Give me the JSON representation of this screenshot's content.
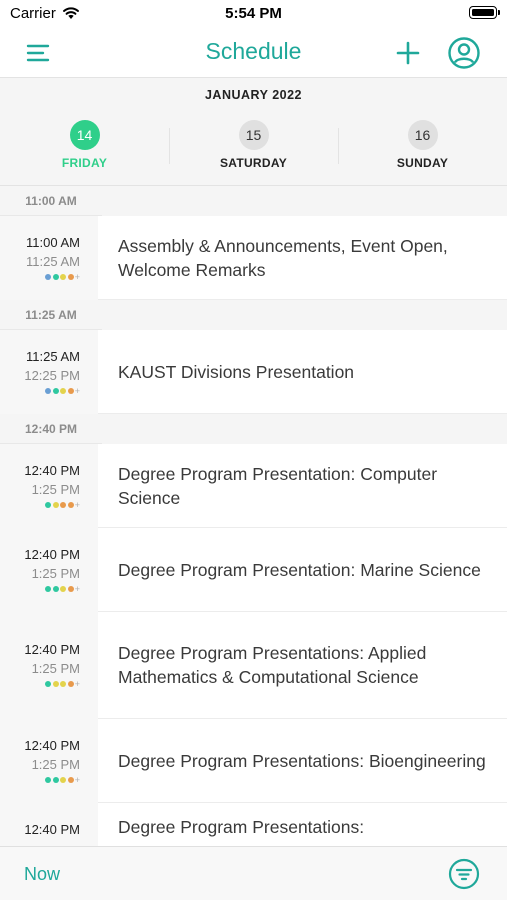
{
  "status_bar": {
    "carrier": "Carrier",
    "time": "5:54 PM"
  },
  "nav": {
    "title": "Schedule"
  },
  "calendar": {
    "month": "JANUARY 2022",
    "days": [
      {
        "num": "14",
        "name": "FRIDAY",
        "active": true
      },
      {
        "num": "15",
        "name": "SATURDAY",
        "active": false
      },
      {
        "num": "16",
        "name": "SUNDAY",
        "active": false
      }
    ]
  },
  "sections": [
    {
      "header": "11:00 AM",
      "events": [
        {
          "start": "11:00 AM",
          "end": "11:25 AM",
          "title": "Assembly & Announcements, Event Open, Welcome Remarks",
          "tag_colors": [
            "#6a9fd4",
            "#2fc8a0",
            "#e3d34c",
            "#e89a4c"
          ]
        }
      ]
    },
    {
      "header": "11:25 AM",
      "events": [
        {
          "start": "11:25 AM",
          "end": "12:25 PM",
          "title": "KAUST Divisions Presentation",
          "tag_colors": [
            "#6a9fd4",
            "#2fc8a0",
            "#e3d34c",
            "#e89a4c"
          ]
        }
      ]
    },
    {
      "header": "12:40 PM",
      "events": [
        {
          "start": "12:40 PM",
          "end": "1:25 PM",
          "title": "Degree Program Presentation: Computer Science",
          "tag_colors": [
            "#2fc8a0",
            "#e3d34c",
            "#e89a4c",
            "#e89a4c"
          ]
        },
        {
          "start": "12:40 PM",
          "end": "1:25 PM",
          "title": "Degree Program Presentation: Marine Science",
          "tag_colors": [
            "#2fc8a0",
            "#2fc8a0",
            "#e3d34c",
            "#e89a4c"
          ]
        },
        {
          "start": "12:40 PM",
          "end": "1:25 PM",
          "title": "Degree Program Presentations: Applied Mathematics & Computational Science",
          "tag_colors": [
            "#2fc8a0",
            "#e3d34c",
            "#e3d34c",
            "#e89a4c"
          ]
        },
        {
          "start": "12:40 PM",
          "end": "1:25 PM",
          "title": "Degree Program Presentations: Bioengineering",
          "tag_colors": [
            "#2fc8a0",
            "#2fc8a0",
            "#e3d34c",
            "#e89a4c"
          ]
        },
        {
          "start": "12:40 PM",
          "end": "",
          "title": "Degree Program Presentations:",
          "tag_colors": []
        }
      ]
    }
  ],
  "tab_bar": {
    "now_label": "Now"
  },
  "colors": {
    "accent": "#1fa89a",
    "active_day": "#2fcf8a"
  },
  "icons": {
    "menu": "hamburger-menu-icon",
    "add": "plus-icon",
    "profile": "user-circle-icon",
    "filter": "filter-icon",
    "wifi": "wifi-icon",
    "battery": "battery-icon"
  }
}
